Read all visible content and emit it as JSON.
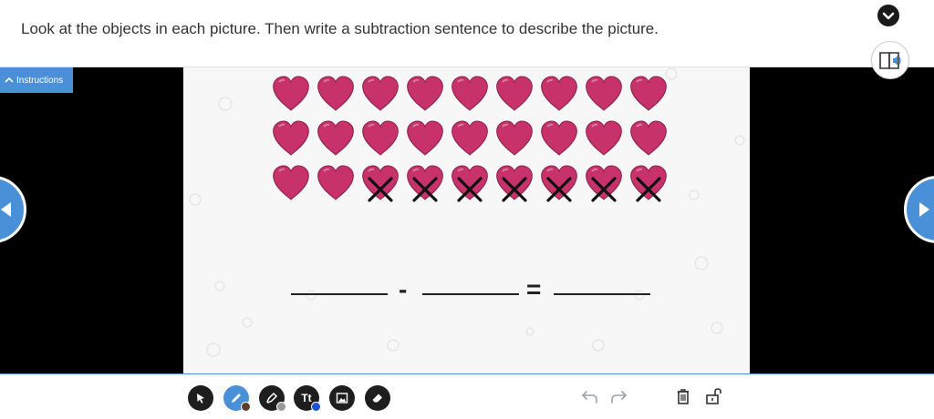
{
  "header": {
    "instruction_text": "Look at the objects in each picture. Then write a subtraction sentence to describe the picture."
  },
  "instructions_tab": {
    "label": "Instructions"
  },
  "activity": {
    "heart_rows": [
      {
        "total": 9,
        "crossed": 0
      },
      {
        "total": 9,
        "crossed": 0
      },
      {
        "total": 9,
        "crossed": 7
      }
    ],
    "heart_color": "#c8326b",
    "equation": {
      "minus_symbol": "-",
      "equals_symbol": "=",
      "blanks": [
        "",
        "",
        ""
      ]
    }
  },
  "toolbar": {
    "tools": [
      "select-tool",
      "pen-tool",
      "highlighter-tool",
      "text-tool",
      "image-tool",
      "eraser-tool"
    ],
    "text_tool_label": "Tt",
    "active_tool": "pen-tool",
    "pen_color": "#5a3d2b",
    "highlighter_color": "#9a9a9a",
    "text_color": "#1f4fd1"
  },
  "colors": {
    "accent": "#4a90d9",
    "stage_background": "#000000"
  }
}
